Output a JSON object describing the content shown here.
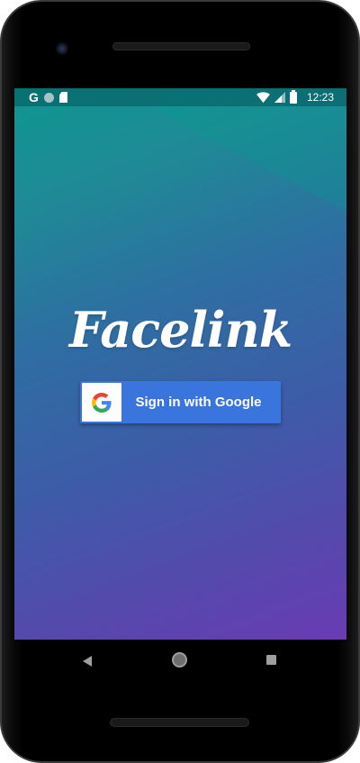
{
  "app": {
    "name": "Facelink"
  },
  "status_bar": {
    "left_icons": [
      "google-g-icon",
      "circle-icon",
      "sd-card-icon"
    ],
    "google_glyph": "G",
    "right_icons": [
      "wifi-icon",
      "signal-icon",
      "battery-icon"
    ],
    "time": "12:23"
  },
  "login": {
    "sign_in_button_label": "Sign in with Google",
    "sign_in_button_icon": "google-logo-icon"
  },
  "navigation": {
    "buttons": [
      "back-icon",
      "home-icon",
      "recents-icon"
    ]
  },
  "colors": {
    "gradient_top": "#0e9690",
    "gradient_bottom": "#6a3bb4",
    "google_button": "#3a74dd",
    "status_text": "#ffffff"
  }
}
